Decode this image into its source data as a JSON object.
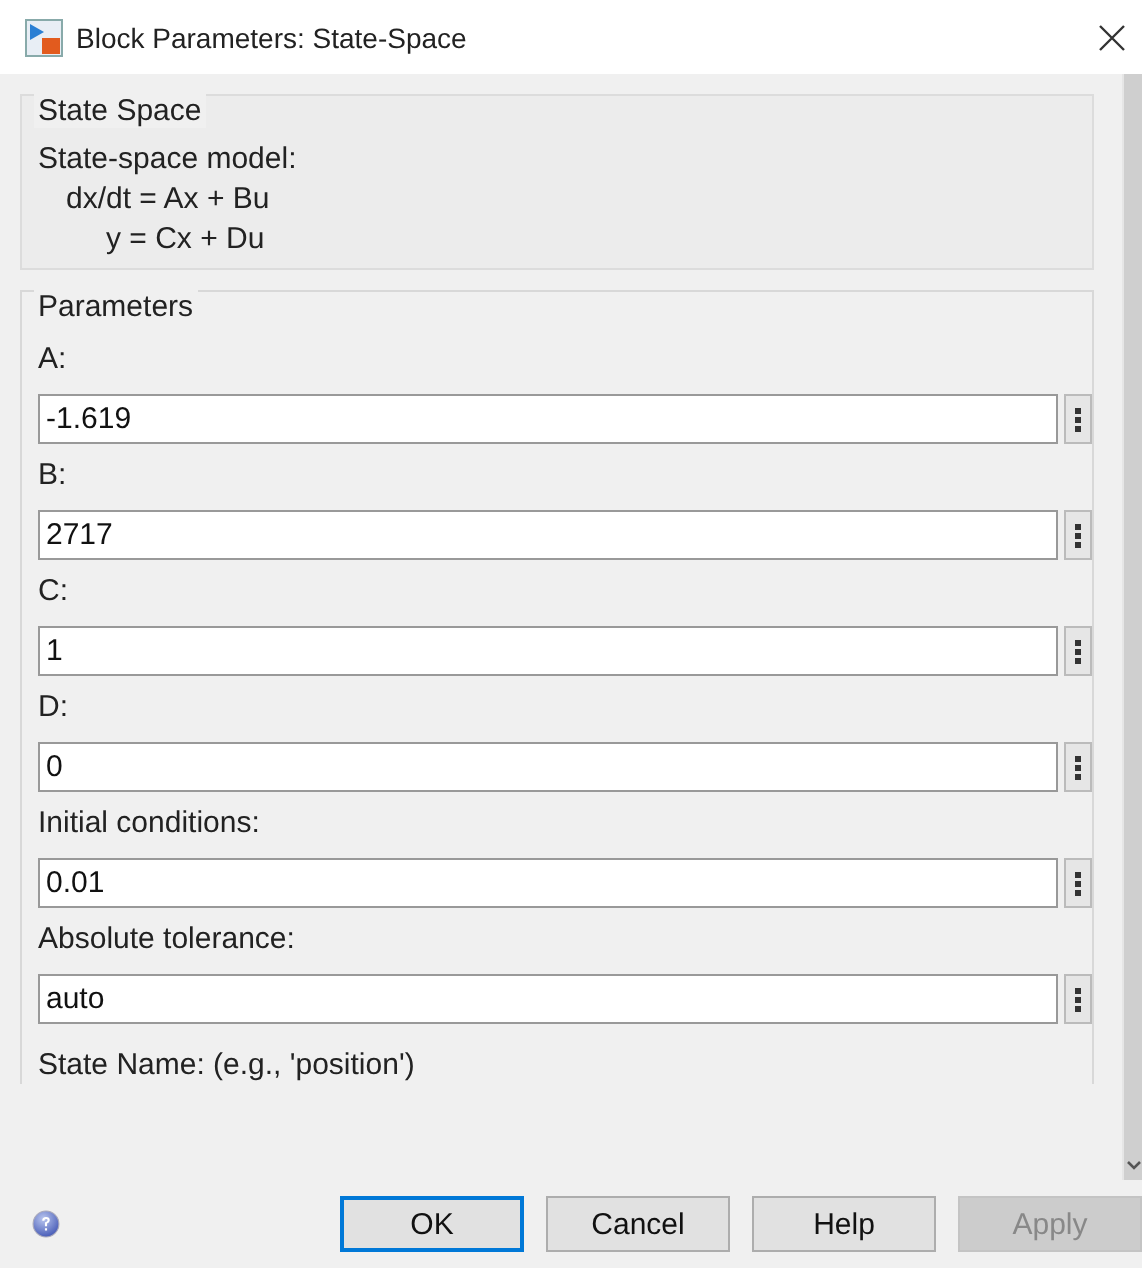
{
  "window": {
    "title": "Block Parameters: State-Space"
  },
  "description": {
    "title": "State Space",
    "lines": [
      "State-space model:",
      "dx/dt = Ax + Bu",
      "y = Cx + Du"
    ]
  },
  "parameters": {
    "title": "Parameters",
    "fields": [
      {
        "label": "A:",
        "value": "-1.619"
      },
      {
        "label": "B:",
        "value": "2717"
      },
      {
        "label": "C:",
        "value": "1"
      },
      {
        "label": "D:",
        "value": "0"
      },
      {
        "label": "Initial conditions:",
        "value": "0.01"
      },
      {
        "label": "Absolute tolerance:",
        "value": "auto"
      }
    ],
    "cut_label": "State Name: (e.g., 'position')"
  },
  "buttons": [
    {
      "label": "OK",
      "default": true,
      "disabled": false
    },
    {
      "label": "Cancel",
      "default": false,
      "disabled": false
    },
    {
      "label": "Help",
      "default": false,
      "disabled": false
    },
    {
      "label": "Apply",
      "default": false,
      "disabled": true
    }
  ]
}
